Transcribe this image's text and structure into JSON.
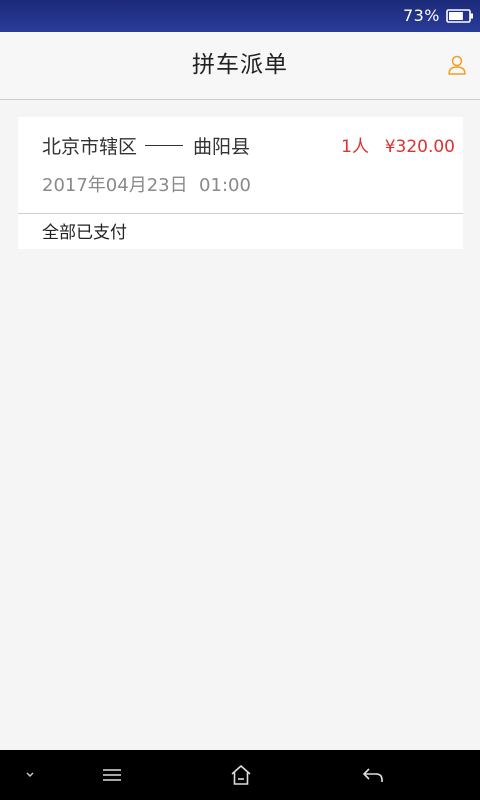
{
  "status_bar": {
    "battery_percent": "73%",
    "battery_level": 0.73,
    "battery_icon": "battery-icon"
  },
  "header": {
    "title": "拼车派单",
    "user_icon": "user-icon",
    "accent_color": "#f0a020"
  },
  "orders": [
    {
      "origin": "北京市辖区",
      "destination": "曲阳县",
      "seats": "1人",
      "price": "¥320.00",
      "datetime": "2017年04月23日  01:00",
      "payment_status": "全部已支付"
    }
  ],
  "colors": {
    "price_red": "#e03131",
    "status_bar": "#1c2a78",
    "background": "#f5f5f5"
  },
  "nav_bar": {
    "icons": [
      "chevron-down-icon",
      "menu-icon",
      "home-icon",
      "back-icon"
    ]
  }
}
